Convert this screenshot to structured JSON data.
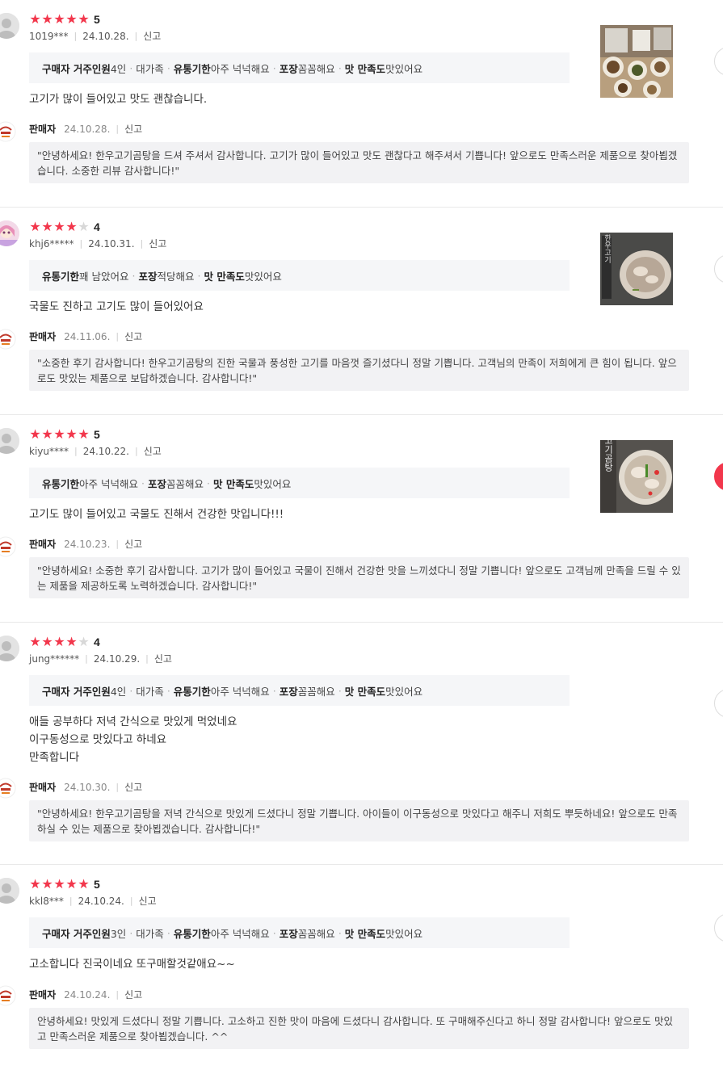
{
  "labels": {
    "report": "신고",
    "seller": "판매자"
  },
  "colors": {
    "star_on": "#f2374c",
    "star_off": "#d8d8d8",
    "accent": "#f2374c"
  },
  "reviews": [
    {
      "rating": 5,
      "score": "5",
      "user": "1019***",
      "date": "24.10.28.",
      "options": [
        {
          "key": "구매자 거주인원",
          "value": "4인"
        },
        {
          "key": "",
          "value": "대가족"
        },
        {
          "key": "유통기한",
          "value": "아주 넉넉해요"
        },
        {
          "key": "포장",
          "value": "꼼꼼해요"
        },
        {
          "key": "맛 만족도",
          "value": "맛있어요"
        }
      ],
      "text": [
        "고기가 많이 들어있고 맛도 괜찮습니다."
      ],
      "seller_date": "24.10.28.",
      "reply": "\"안녕하세요! 한우고기곰탕을 드셔 주셔서 감사합니다. 고기가 많이 들어있고 맛도 괜찮다고 해주셔서 기쁩니다! 앞으로도 만족스러운 제품으로 찾아뵙겠습니다. 소중한 리뷰 감사합니다!\"",
      "image": "food-plates-photo"
    },
    {
      "rating": 4,
      "score": "4",
      "user": "khj6*****",
      "date": "24.10.31.",
      "options": [
        {
          "key": "유통기한",
          "value": "꽤 남았어요"
        },
        {
          "key": "포장",
          "value": "적당해요"
        },
        {
          "key": "맛 만족도",
          "value": "맛있어요"
        }
      ],
      "text": [
        "국물도 진하고 고기도 많이 들어있어요"
      ],
      "seller_date": "24.11.06.",
      "reply": "\"소중한 후기 감사합니다! 한우고기곰탕의 진한 국물과 풍성한 고기를 마음껏 즐기셨다니 정말 기쁩니다. 고객님의 만족이 저희에게 큰 힘이 됩니다. 앞으로도 맛있는 제품으로 보답하겠습니다. 감사합니다!\"",
      "image": "gomtang-package-photo"
    },
    {
      "rating": 5,
      "score": "5",
      "user": "kiyu****",
      "date": "24.10.22.",
      "options": [
        {
          "key": "유통기한",
          "value": "아주 넉넉해요"
        },
        {
          "key": "포장",
          "value": "꼼꼼해요"
        },
        {
          "key": "맛 만족도",
          "value": "맛있어요"
        }
      ],
      "text": [
        "고기도 많이 들어있고 국물도 진해서 건강한 맛입니다!!!"
      ],
      "seller_date": "24.10.23.",
      "reply": "\"안녕하세요! 소중한 후기 감사합니다. 고기가 많이 들어있고 국물이 진해서 건강한 맛을 느끼셨다니 정말 기쁩니다! 앞으로도 고객님께 만족을 드릴 수 있는 제품을 제공하도록 노력하겠습니다. 감사합니다!\"",
      "image": "gomtang-package-photo-2",
      "thumb_text": "한우고기곰탕"
    },
    {
      "rating": 4,
      "score": "4",
      "user": "jung******",
      "date": "24.10.29.",
      "options": [
        {
          "key": "구매자 거주인원",
          "value": "4인"
        },
        {
          "key": "",
          "value": "대가족"
        },
        {
          "key": "유통기한",
          "value": "아주 넉넉해요"
        },
        {
          "key": "포장",
          "value": "꼼꼼해요"
        },
        {
          "key": "맛 만족도",
          "value": "맛있어요"
        }
      ],
      "text": [
        "애들 공부하다 저녁 간식으로 맛있게 먹었네요",
        "이구동성으로 맛있다고 하네요",
        "만족합니다"
      ],
      "seller_date": "24.10.30.",
      "reply": "\"안녕하세요! 한우고기곰탕을 저녁 간식으로 맛있게 드셨다니 정말 기쁩니다. 아이들이 이구동성으로 맛있다고 해주니 저희도 뿌듯하네요! 앞으로도 만족하실 수 있는 제품으로 찾아뵙겠습니다. 감사합니다!\""
    },
    {
      "rating": 5,
      "score": "5",
      "user": "kkl8***",
      "date": "24.10.24.",
      "options": [
        {
          "key": "구매자 거주인원",
          "value": "3인"
        },
        {
          "key": "",
          "value": "대가족"
        },
        {
          "key": "유통기한",
          "value": "아주 넉넉해요"
        },
        {
          "key": "포장",
          "value": "꼼꼼해요"
        },
        {
          "key": "맛 만족도",
          "value": "맛있어요"
        }
      ],
      "text": [
        "고소합니다 진국이네요 또구매할것같애요~~"
      ],
      "seller_date": "24.10.24.",
      "reply": "안녕하세요! 맛있게 드셨다니 정말 기쁩니다. 고소하고 진한 맛이 마음에 드셨다니 감사합니다. 또 구매해주신다고 하니 정말 감사합니다! 앞으로도 맛있고 만족스러운 제품으로 찾아뵙겠습니다. ^^"
    }
  ]
}
